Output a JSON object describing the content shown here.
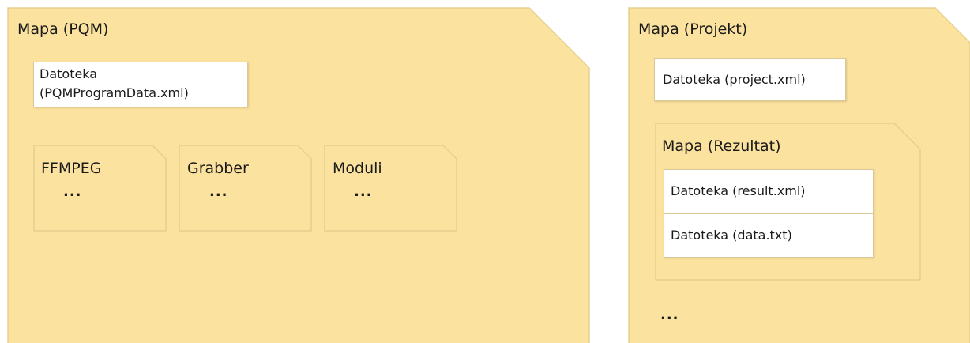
{
  "colors": {
    "folder_fill": "#fbe29f",
    "folder_stroke": "#e6cf8f",
    "file_fill": "#ffffff"
  },
  "folder_pqm": {
    "title": "Mapa (PQM)",
    "file_line1": "Datoteka",
    "file_line2": "(PQMProgramData.xml)",
    "subfolders": [
      {
        "title": "FFMPEG",
        "ellipsis": "..."
      },
      {
        "title": "Grabber",
        "ellipsis": "..."
      },
      {
        "title": "Moduli",
        "ellipsis": "..."
      }
    ]
  },
  "folder_projekt": {
    "title": "Mapa (Projekt)",
    "file": "Datoteka (project.xml)",
    "result_folder": {
      "title": "Mapa (Rezultat)",
      "files": [
        "Datoteka (result.xml)",
        "Datoteka (data.txt)"
      ]
    },
    "ellipsis": "..."
  }
}
